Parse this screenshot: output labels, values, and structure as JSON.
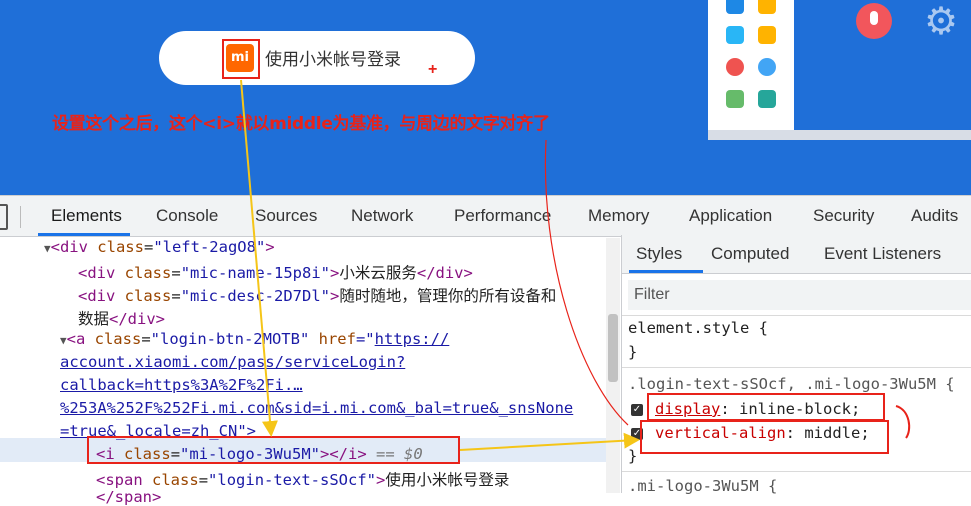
{
  "hero": {
    "login_text": "使用小米帐号登录",
    "logo_text": "mi",
    "plus": "+",
    "note": "设置这个之后，这个<i>就以middle为基准，与周边的文字对齐了"
  },
  "devtools": {
    "tabs": [
      "Elements",
      "Console",
      "Sources",
      "Network",
      "Performance",
      "Memory",
      "Application",
      "Security",
      "Audits"
    ],
    "active_tab": "Elements",
    "dom": {
      "l1": {
        "tag_open": "<div",
        "attr": "class",
        "val": "\"left-2agO8\"",
        "tag_close": ">"
      },
      "l2": {
        "tag_open": "<div",
        "attr": "class",
        "val": "\"mic-name-15p8i\"",
        "text": "小米云服务",
        "end": "</div>"
      },
      "l3": {
        "tag_open": "<div",
        "attr": "class",
        "val": "\"mic-desc-2D7Dl\"",
        "text": "随时随地，管理你的所有设备和"
      },
      "l4": {
        "text": "数据",
        "end": "</div>"
      },
      "l5": {
        "tag_open": "<a",
        "attr1": "class",
        "val1": "\"login-btn-2MOTB\"",
        "attr2": "href",
        "val2": "=\"",
        "link": "https://"
      },
      "l6": {
        "link": "account.xiaomi.com/pass/serviceLogin?"
      },
      "l7": {
        "link": "callback=https%3A%2F%2Fi.…"
      },
      "l8": {
        "link": "%253A%252F%252Fi.mi.com&sid=i.mi.com&_bal=true&_snsNone"
      },
      "l9": {
        "link": "=true&_locale=zh_CN",
        "tail": "\">"
      },
      "l10": {
        "tag_open": "<i",
        "attr": "class",
        "val": "\"mi-logo-3Wu5M\"",
        "tag_close": "></i>",
        "eq": "== $0"
      },
      "l11": {
        "tag_open": "<span",
        "attr": "class",
        "val": "\"login-text-sSOcf\"",
        "text": "使用小米帐号登录"
      },
      "l12": {
        "end": "</span>"
      }
    },
    "styles_tabs": [
      "Styles",
      "Computed",
      "Event Listeners"
    ],
    "filter_placeholder": "Filter",
    "element_style": "element.style {",
    "close_brace": "}",
    "rule_selector": ".login-text-sSOcf, .mi-logo-3Wu5M {",
    "prop1": {
      "name": "display",
      "value": "inline-block;"
    },
    "prop2": {
      "name": "vertical-align",
      "value": "middle;"
    },
    "next_selector": ".mi-logo-3Wu5M {"
  },
  "colors": {
    "accent": "#1a73e8",
    "annotation": "#e8231a",
    "arrow": "#f5c518",
    "hero": "#1f6fd8"
  }
}
